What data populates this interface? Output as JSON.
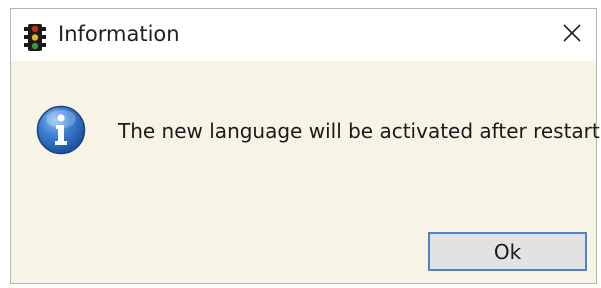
{
  "dialog": {
    "title": "Information",
    "message": "The new language will be activated after restart.",
    "ok_label": "Ok",
    "icons": {
      "app": "traffic-light-icon",
      "message": "info-icon",
      "close": "close-icon"
    },
    "colors": {
      "body_background": "#f7f4e6",
      "titlebar_background": "#ffffff",
      "button_border": "#4a86c8",
      "button_background": "#e2e2e2"
    }
  }
}
